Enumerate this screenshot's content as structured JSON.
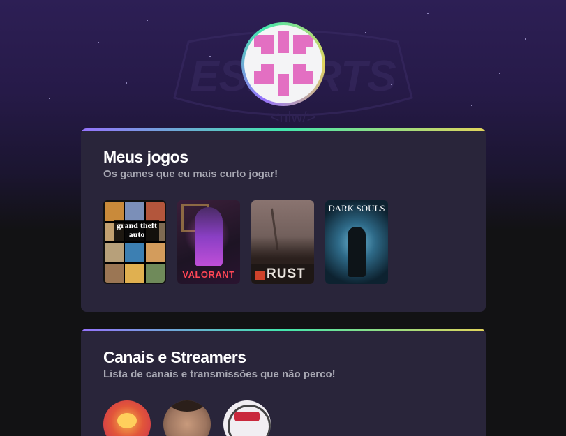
{
  "profile": {
    "watermark_text": "ESPORTS",
    "watermark_sub": "<nlw/>"
  },
  "games_section": {
    "title": "Meus jogos",
    "subtitle": "Os games que eu mais curto jogar!",
    "games": [
      {
        "name": "grand theft auto",
        "cover_text": "grand theft auto"
      },
      {
        "name": "VALORANT",
        "cover_text": "VALORANT"
      },
      {
        "name": "RUST",
        "cover_text": "RUST"
      },
      {
        "name": "DARK SOULS",
        "cover_text": "DARK SOULS"
      }
    ]
  },
  "channels_section": {
    "title": "Canais e Streamers",
    "subtitle": "Lista de canais e transmissões que não perco!"
  },
  "colors": {
    "background": "#121214",
    "card": "#29253a",
    "gradient": [
      "#9572fc",
      "#43e7ad",
      "#e2d45c"
    ],
    "avatar_pink": "#e36fc2",
    "text_primary": "#ffffff",
    "text_secondary": "#a8a8b3"
  }
}
